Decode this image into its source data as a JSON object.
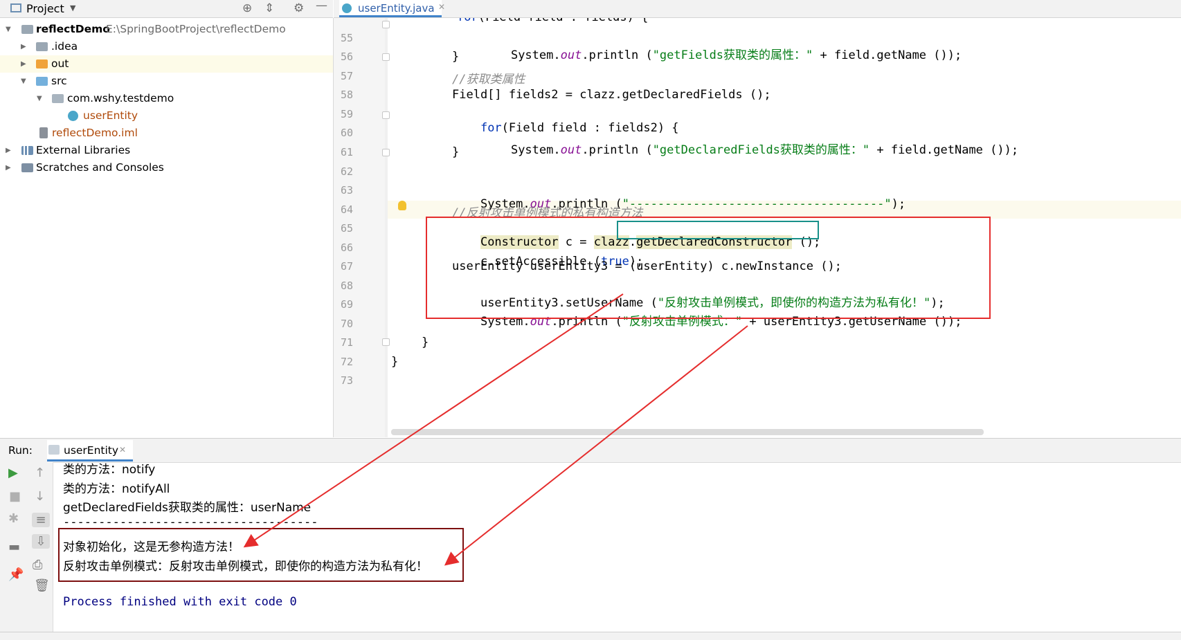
{
  "project_panel": {
    "title": "Project",
    "tree": [
      {
        "label": "reflectDemo",
        "path": "E:\\SpringBootProject\\reflectDemo"
      },
      {
        "label": ".idea"
      },
      {
        "label": "out"
      },
      {
        "label": "src"
      },
      {
        "label": "com.wshy.testdemo"
      },
      {
        "label": "userEntity"
      },
      {
        "label": "reflectDemo.iml"
      },
      {
        "label": "External Libraries"
      },
      {
        "label": "Scratches and Consoles"
      }
    ]
  },
  "editor": {
    "tab": "userEntity.java",
    "line_numbers": [
      "55",
      "56",
      "57",
      "58",
      "59",
      "60",
      "61",
      "62",
      "63",
      "64",
      "65",
      "66",
      "67",
      "68",
      "69",
      "70",
      "71",
      "72",
      "73"
    ],
    "lines": {
      "l55": {
        "a": "System.",
        "b": "out",
        "c": ".println (",
        "d": "\"getFields获取类的属性：\"",
        "e": " + field.getName ());"
      },
      "l56": "}",
      "l57": "//获取类属性",
      "l58": "Field[] fields2 = clazz.getDeclaredFields ();",
      "l59": {
        "a": "for",
        "b": "(Field field : fields2) {"
      },
      "l60": {
        "a": "System.",
        "b": "out",
        "c": ".println (",
        "d": "\"getDeclaredFields获取类的属性：\"",
        "e": " + field.getName ());"
      },
      "l61": "}",
      "l63": {
        "a": "System.",
        "b": "out",
        "c": ".println (",
        "d": "\"------------------------------------\"",
        "e": ");"
      },
      "l64": "//反射攻击单例模式的私有构造方法",
      "l65": {
        "a": "Constructor",
        "b": " c = ",
        "c": "clazz",
        "d": ".",
        "e": "getDeclaredConstructor",
        "f": " ();"
      },
      "l66": {
        "a": "c.setAccessible (",
        "b": "true",
        "c": ");"
      },
      "l67": "userEntity userEntity3 = (userEntity) c.newInstance ();",
      "l68": {
        "a": "userEntity3.setUserName (",
        "b": "\"反射攻击单例模式，即使你的构造方法为私有化！\"",
        "c": ");"
      },
      "l69": {
        "a": "System.",
        "b": "out",
        "c": ".println (",
        "d": "\"反射攻击单例模式：\"",
        "e": " + userEntity3.getUserName ());"
      },
      "l71": "}",
      "l72": "}"
    }
  },
  "run_panel": {
    "label": "Run:",
    "tab": "userEntity",
    "output": [
      "类的方法：notify",
      "类的方法：notifyAll",
      "getDeclaredFields获取类的属性：userName",
      "------------------------------------",
      "对象初始化，这是无参构造方法！",
      "反射攻击单例模式：反射攻击单例模式，即使你的构造方法为私有化！"
    ],
    "finished": "Process finished with exit code 0"
  },
  "colors": {
    "highlight_box": "#e52d2d",
    "output_box": "#7d1010",
    "match_box": "#18908a",
    "arrow": "#e52d2d"
  }
}
